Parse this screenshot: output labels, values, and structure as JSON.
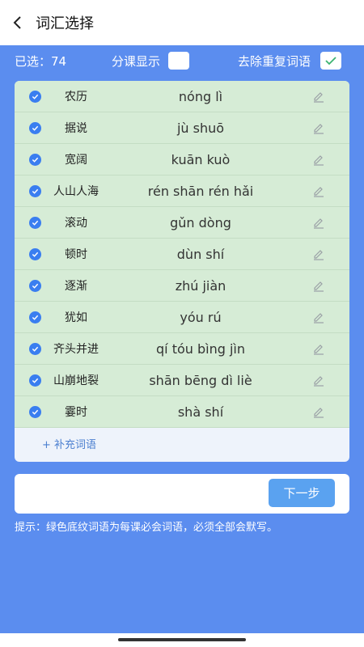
{
  "header": {
    "title": "词汇选择"
  },
  "filter": {
    "selected_text": "已选：74",
    "by_lesson_label": "分课显示",
    "by_lesson_checked": false,
    "dedupe_label": "去除重复词语",
    "dedupe_checked": true
  },
  "words": [
    {
      "word": "农历",
      "pinyin": "nóng lì"
    },
    {
      "word": "据说",
      "pinyin": "jù shuō"
    },
    {
      "word": "宽阔",
      "pinyin": "kuān kuò"
    },
    {
      "word": "人山人海",
      "pinyin": "rén shān rén hǎi"
    },
    {
      "word": "滚动",
      "pinyin": "gǔn dòng"
    },
    {
      "word": "顿时",
      "pinyin": "dùn shí"
    },
    {
      "word": "逐渐",
      "pinyin": "zhú jiàn"
    },
    {
      "word": "犹如",
      "pinyin": "yóu rú"
    },
    {
      "word": "齐头并进",
      "pinyin": "qí tóu bìng jìn"
    },
    {
      "word": "山崩地裂",
      "pinyin": "shān bēng dì liè"
    },
    {
      "word": "霎时",
      "pinyin": "shà shí"
    }
  ],
  "add_label": "+ 补充词语",
  "next_label": "下一步",
  "hint": "提示：绿色底纹词语为每课必会词语，必须全部会默写。",
  "colors": {
    "background": "#5b8def",
    "row_green": "#d6ecd6",
    "check_blue": "#3a7ef0",
    "button": "#5aa2f0"
  }
}
